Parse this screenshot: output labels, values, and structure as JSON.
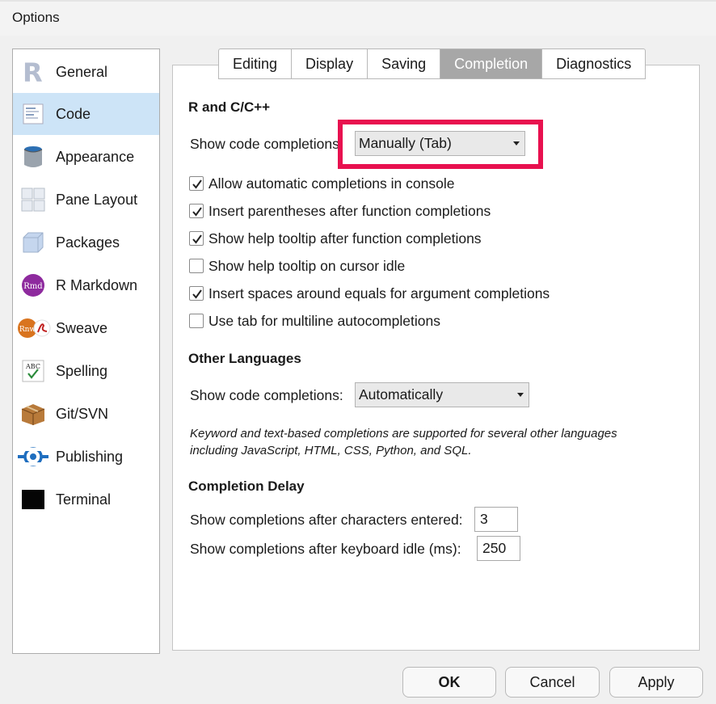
{
  "window": {
    "title": "Options"
  },
  "sidebar": {
    "items": [
      {
        "label": "General",
        "icon": "r-logo-icon"
      },
      {
        "label": "Code",
        "icon": "code-document-icon",
        "selected": true
      },
      {
        "label": "Appearance",
        "icon": "paint-bucket-icon"
      },
      {
        "label": "Pane Layout",
        "icon": "pane-grid-icon"
      },
      {
        "label": "Packages",
        "icon": "package-cube-icon"
      },
      {
        "label": "R Markdown",
        "icon": "rmd-icon",
        "badge": "Rmd"
      },
      {
        "label": "Sweave",
        "icon": "sweave-icon",
        "badge": "Rnw"
      },
      {
        "label": "Spelling",
        "icon": "spelling-abc-icon",
        "badge": "ABC"
      },
      {
        "label": "Git/SVN",
        "icon": "git-box-icon"
      },
      {
        "label": "Publishing",
        "icon": "publishing-icon"
      },
      {
        "label": "Terminal",
        "icon": "terminal-icon"
      }
    ]
  },
  "tabs": [
    {
      "label": "Editing"
    },
    {
      "label": "Display"
    },
    {
      "label": "Saving"
    },
    {
      "label": "Completion",
      "active": true
    },
    {
      "label": "Diagnostics"
    }
  ],
  "r_section": {
    "heading": "R and C/C++",
    "show_completions_label": "Show code completions:",
    "show_completions_value": "Manually (Tab)",
    "checkboxes": [
      {
        "label": "Allow automatic completions in console",
        "checked": true
      },
      {
        "label": "Insert parentheses after function completions",
        "checked": true
      },
      {
        "label": "Show help tooltip after function completions",
        "checked": true
      },
      {
        "label": "Show help tooltip on cursor idle",
        "checked": false
      },
      {
        "label": "Insert spaces around equals for argument completions",
        "checked": true
      },
      {
        "label": "Use tab for multiline autocompletions",
        "checked": false
      }
    ]
  },
  "other_section": {
    "heading": "Other Languages",
    "show_completions_label": "Show code completions:",
    "show_completions_value": "Automatically",
    "note": "Keyword and text-based completions are supported for several other languages including JavaScript, HTML, CSS, Python, and SQL."
  },
  "delay_section": {
    "heading": "Completion Delay",
    "chars_label": "Show completions after characters entered:",
    "chars_value": "3",
    "idle_label": "Show completions after keyboard idle (ms):",
    "idle_value": "250"
  },
  "buttons": {
    "ok": "OK",
    "cancel": "Cancel",
    "apply": "Apply"
  },
  "colors": {
    "highlight": "#e8114f",
    "selected": "#cde4f7",
    "active_tab": "#a7a7a7"
  }
}
